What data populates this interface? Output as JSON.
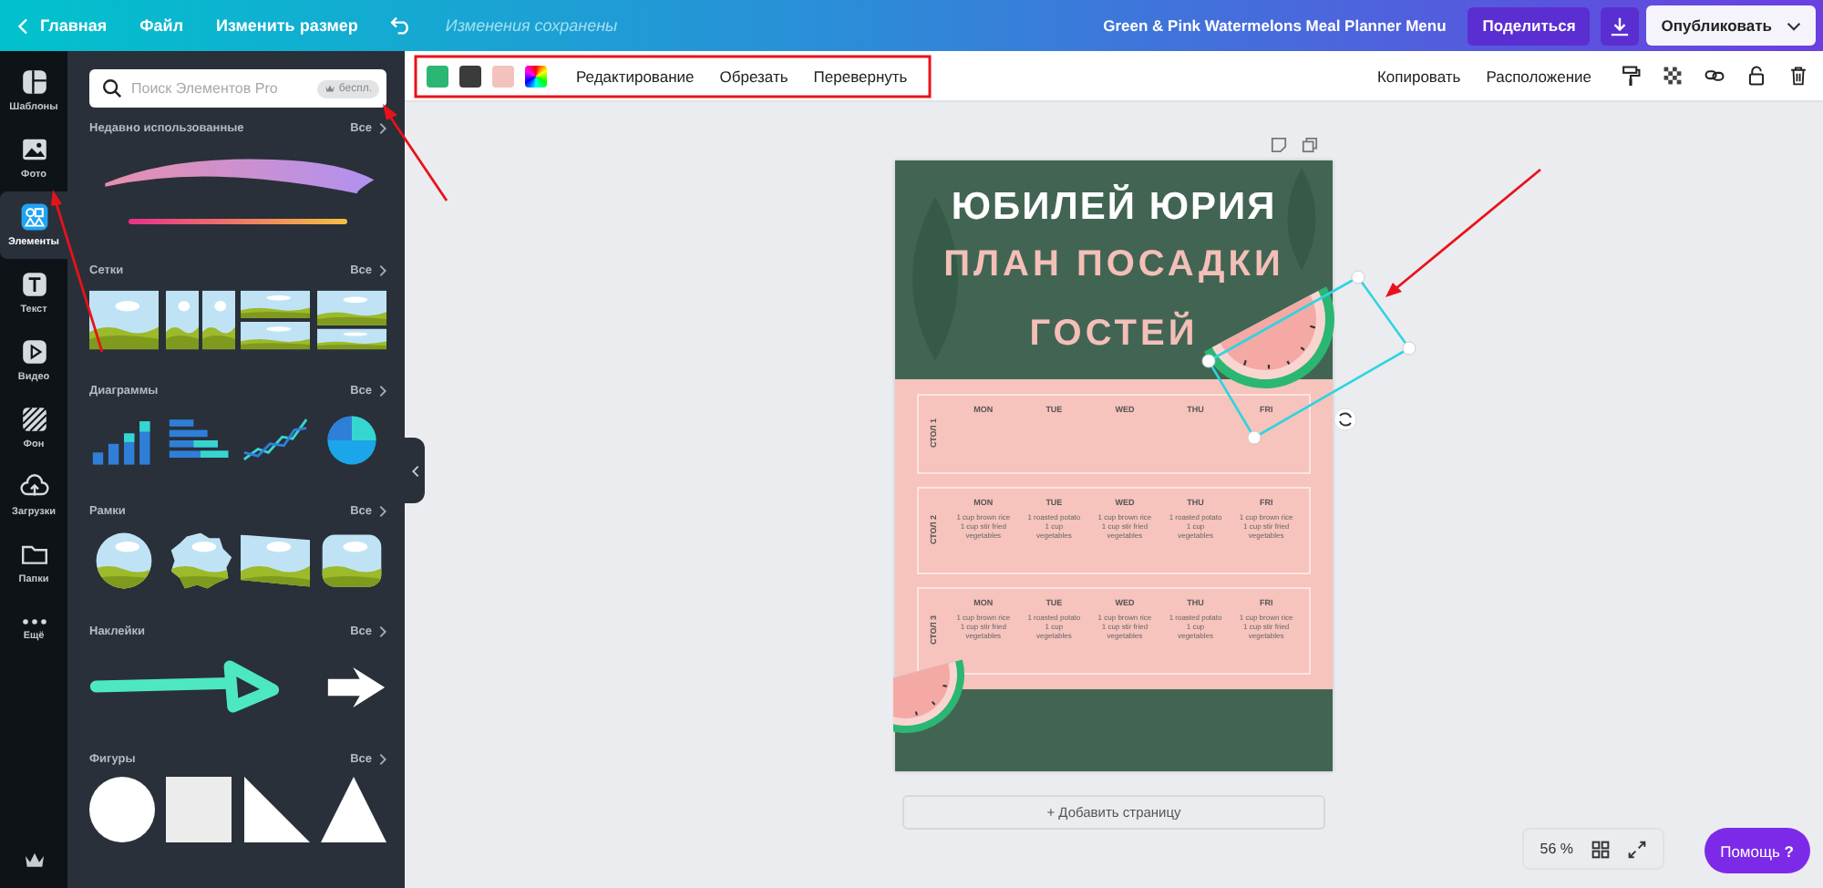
{
  "topbar": {
    "back": "Главная",
    "menu": [
      "Файл",
      "Изменить размер"
    ],
    "status": "Изменения сохранены",
    "title": "Green & Pink Watermelons Meal Planner Menu",
    "share": "Поделиться",
    "publish": "Опубликовать"
  },
  "rail": [
    {
      "label": "Шаблоны",
      "kind": "templates",
      "selected": false
    },
    {
      "label": "Фото",
      "kind": "photo",
      "selected": false
    },
    {
      "label": "Элементы",
      "kind": "elements",
      "selected": true
    },
    {
      "label": "Текст",
      "kind": "text",
      "selected": false
    },
    {
      "label": "Видео",
      "kind": "video",
      "selected": false
    },
    {
      "label": "Фон",
      "kind": "background",
      "selected": false
    },
    {
      "label": "Загрузки",
      "kind": "uploads",
      "selected": false
    },
    {
      "label": "Папки",
      "kind": "folders",
      "selected": false
    },
    {
      "label": "Ещё",
      "kind": "more",
      "selected": false
    }
  ],
  "panel": {
    "search": {
      "placeholder": "Поиск Элементов Pro",
      "badge": "беспл."
    },
    "sections": [
      {
        "title": "Недавно использованные",
        "more": "Все",
        "kind": "recent"
      },
      {
        "title": "Сетки",
        "more": "Все",
        "kind": "grids"
      },
      {
        "title": "Диаграммы",
        "more": "Все",
        "kind": "charts"
      },
      {
        "title": "Рамки",
        "more": "Все",
        "kind": "frames"
      },
      {
        "title": "Наклейки",
        "more": "Все",
        "kind": "stickers"
      },
      {
        "title": "Фигуры",
        "more": "Все",
        "kind": "shapes"
      }
    ]
  },
  "toolbar": {
    "swatches": [
      {
        "color": "#2bb673"
      },
      {
        "color": "#3b3b3b"
      },
      {
        "color": "#f4c2bd"
      }
    ],
    "actions": [
      "Редактирование",
      "Обрезать",
      "Перевернуть"
    ],
    "right": [
      "Копировать",
      "Расположение"
    ]
  },
  "document": {
    "title": "ЮБИЛЕЙ ЮРИЯ",
    "subtitle": [
      "ПЛАН ПОСАДКИ",
      "ГОСТЕЙ"
    ],
    "tables": [
      {
        "label": "СТОЛ 1",
        "days": [
          {
            "day": "MON"
          },
          {
            "day": "TUE"
          },
          {
            "day": "WED"
          },
          {
            "day": "THU"
          },
          {
            "day": "FRI"
          }
        ]
      },
      {
        "label": "СТОЛ 2",
        "days": [
          {
            "day": "MON",
            "meal": [
              "1 cup brown rice",
              "1 cup stir fried vegetables"
            ]
          },
          {
            "day": "TUE",
            "meal": [
              "1 roasted potato",
              "1 cup vegetables"
            ]
          },
          {
            "day": "WED",
            "meal": [
              "1 cup brown rice",
              "1 cup stir fried vegetables"
            ]
          },
          {
            "day": "THU",
            "meal": [
              "1 roasted potato",
              "1 cup vegetables"
            ]
          },
          {
            "day": "FRI",
            "meal": [
              "1 cup brown rice",
              "1 cup stir fried vegetables"
            ]
          }
        ]
      },
      {
        "label": "СТОЛ 3",
        "days": [
          {
            "day": "MON",
            "meal": [
              "1 cup brown rice",
              "1 cup stir fried vegetables"
            ]
          },
          {
            "day": "TUE",
            "meal": [
              "1 roasted potato",
              "1 cup vegetables"
            ]
          },
          {
            "day": "WED",
            "meal": [
              "1 cup brown rice",
              "1 cup stir fried vegetables"
            ]
          },
          {
            "day": "THU",
            "meal": [
              "1 roasted potato",
              "1 cup vegetables"
            ]
          },
          {
            "day": "FRI",
            "meal": [
              "1 cup brown rice",
              "1 cup stir fried vegetables"
            ]
          }
        ]
      }
    ]
  },
  "add_page": "+ Добавить страницу",
  "zoom": "56 %",
  "help": {
    "label": "Помощь",
    "mark": "?"
  }
}
